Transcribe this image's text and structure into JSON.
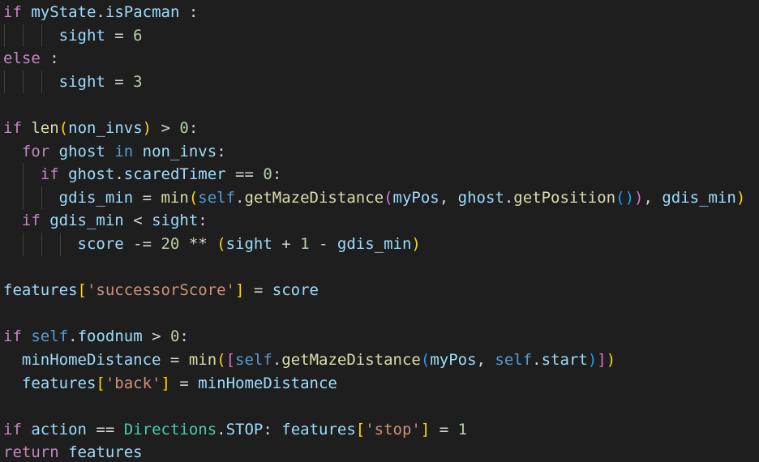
{
  "editor": {
    "theme_colors": {
      "background": "#1e1e1e",
      "keyword": "#c586c0",
      "variable": "#9cdcfe",
      "number": "#b5cea8",
      "function": "#dcdcaa",
      "string": "#ce9178",
      "class": "#4ec9b0",
      "self": "#569cd6",
      "bracket1": "#ffd700",
      "bracket2": "#da70d6",
      "bracket3": "#179fff"
    },
    "lines": [
      [
        {
          "t": "if",
          "c": "k"
        },
        {
          "t": " "
        },
        {
          "t": "myState",
          "c": "v"
        },
        {
          "t": "."
        },
        {
          "t": "isPacman",
          "c": "v"
        },
        {
          "t": " :"
        }
      ],
      [
        {
          "t": "      "
        },
        {
          "t": "sight",
          "c": "v"
        },
        {
          "t": " = "
        },
        {
          "t": "6",
          "c": "n"
        }
      ],
      [
        {
          "t": "else",
          "c": "k"
        },
        {
          "t": " :"
        }
      ],
      [
        {
          "t": "      "
        },
        {
          "t": "sight",
          "c": "v"
        },
        {
          "t": " = "
        },
        {
          "t": "3",
          "c": "n"
        }
      ],
      [],
      [
        {
          "t": "if",
          "c": "k"
        },
        {
          "t": " "
        },
        {
          "t": "len",
          "c": "f"
        },
        {
          "t": "(",
          "c": "b1"
        },
        {
          "t": "non_invs",
          "c": "v"
        },
        {
          "t": ")",
          "c": "b1"
        },
        {
          "t": " > "
        },
        {
          "t": "0",
          "c": "n"
        },
        {
          "t": ":"
        }
      ],
      [
        {
          "t": "  "
        },
        {
          "t": "for",
          "c": "k"
        },
        {
          "t": " "
        },
        {
          "t": "ghost",
          "c": "v"
        },
        {
          "t": " "
        },
        {
          "t": "in",
          "c": "kb"
        },
        {
          "t": " "
        },
        {
          "t": "non_invs",
          "c": "v"
        },
        {
          "t": ":"
        }
      ],
      [
        {
          "t": "    "
        },
        {
          "t": "if",
          "c": "k"
        },
        {
          "t": " "
        },
        {
          "t": "ghost",
          "c": "v"
        },
        {
          "t": "."
        },
        {
          "t": "scaredTimer",
          "c": "v"
        },
        {
          "t": " == "
        },
        {
          "t": "0",
          "c": "n"
        },
        {
          "t": ":"
        }
      ],
      [
        {
          "t": "      "
        },
        {
          "t": "gdis_min",
          "c": "v"
        },
        {
          "t": " = "
        },
        {
          "t": "min",
          "c": "f"
        },
        {
          "t": "(",
          "c": "b1"
        },
        {
          "t": "self",
          "c": "kb"
        },
        {
          "t": "."
        },
        {
          "t": "getMazeDistance",
          "c": "f"
        },
        {
          "t": "(",
          "c": "b2"
        },
        {
          "t": "myPos",
          "c": "v"
        },
        {
          "t": ", "
        },
        {
          "t": "ghost",
          "c": "v"
        },
        {
          "t": "."
        },
        {
          "t": "getPosition",
          "c": "f"
        },
        {
          "t": "()",
          "c": "b3"
        },
        {
          "t": ")",
          "c": "b2"
        },
        {
          "t": ", "
        },
        {
          "t": "gdis_min",
          "c": "v"
        },
        {
          "t": ")",
          "c": "b1"
        }
      ],
      [
        {
          "t": "  "
        },
        {
          "t": "if",
          "c": "k"
        },
        {
          "t": " "
        },
        {
          "t": "gdis_min",
          "c": "v"
        },
        {
          "t": " < "
        },
        {
          "t": "sight",
          "c": "v"
        },
        {
          "t": ":"
        }
      ],
      [
        {
          "t": "        "
        },
        {
          "t": "score",
          "c": "v"
        },
        {
          "t": " -= "
        },
        {
          "t": "20",
          "c": "n"
        },
        {
          "t": " ** "
        },
        {
          "t": "(",
          "c": "b1"
        },
        {
          "t": "sight",
          "c": "v"
        },
        {
          "t": " + "
        },
        {
          "t": "1",
          "c": "n"
        },
        {
          "t": " - "
        },
        {
          "t": "gdis_min",
          "c": "v"
        },
        {
          "t": ")",
          "c": "b1"
        }
      ],
      [],
      [
        {
          "t": "features",
          "c": "v"
        },
        {
          "t": "[",
          "c": "b1"
        },
        {
          "t": "'successorScore'",
          "c": "s"
        },
        {
          "t": "]",
          "c": "b1"
        },
        {
          "t": " = "
        },
        {
          "t": "score",
          "c": "v"
        }
      ],
      [],
      [
        {
          "t": "if",
          "c": "k"
        },
        {
          "t": " "
        },
        {
          "t": "self",
          "c": "kb"
        },
        {
          "t": "."
        },
        {
          "t": "foodnum",
          "c": "v"
        },
        {
          "t": " > "
        },
        {
          "t": "0",
          "c": "n"
        },
        {
          "t": ":"
        }
      ],
      [
        {
          "t": "  "
        },
        {
          "t": "minHomeDistance",
          "c": "v"
        },
        {
          "t": " = "
        },
        {
          "t": "min",
          "c": "f"
        },
        {
          "t": "(",
          "c": "b1"
        },
        {
          "t": "[",
          "c": "b2"
        },
        {
          "t": "self",
          "c": "kb"
        },
        {
          "t": "."
        },
        {
          "t": "getMazeDistance",
          "c": "f"
        },
        {
          "t": "(",
          "c": "b3"
        },
        {
          "t": "myPos",
          "c": "v"
        },
        {
          "t": ", "
        },
        {
          "t": "self",
          "c": "kb"
        },
        {
          "t": "."
        },
        {
          "t": "start",
          "c": "v"
        },
        {
          "t": ")",
          "c": "b3"
        },
        {
          "t": "]",
          "c": "b2"
        },
        {
          "t": ")",
          "c": "b1"
        }
      ],
      [
        {
          "t": "  "
        },
        {
          "t": "features",
          "c": "v"
        },
        {
          "t": "[",
          "c": "b1"
        },
        {
          "t": "'back'",
          "c": "s"
        },
        {
          "t": "]",
          "c": "b1"
        },
        {
          "t": " = "
        },
        {
          "t": "minHomeDistance",
          "c": "v"
        }
      ],
      [],
      [
        {
          "t": "if",
          "c": "k"
        },
        {
          "t": " "
        },
        {
          "t": "action",
          "c": "v"
        },
        {
          "t": " == "
        },
        {
          "t": "Directions",
          "c": "c"
        },
        {
          "t": "."
        },
        {
          "t": "STOP",
          "c": "v"
        },
        {
          "t": ": "
        },
        {
          "t": "features",
          "c": "v"
        },
        {
          "t": "[",
          "c": "b1"
        },
        {
          "t": "'stop'",
          "c": "s"
        },
        {
          "t": "]",
          "c": "b1"
        },
        {
          "t": " = "
        },
        {
          "t": "1",
          "c": "n"
        }
      ],
      [
        {
          "t": "return",
          "c": "k"
        },
        {
          "t": " "
        },
        {
          "t": "features",
          "c": "v"
        }
      ]
    ]
  }
}
